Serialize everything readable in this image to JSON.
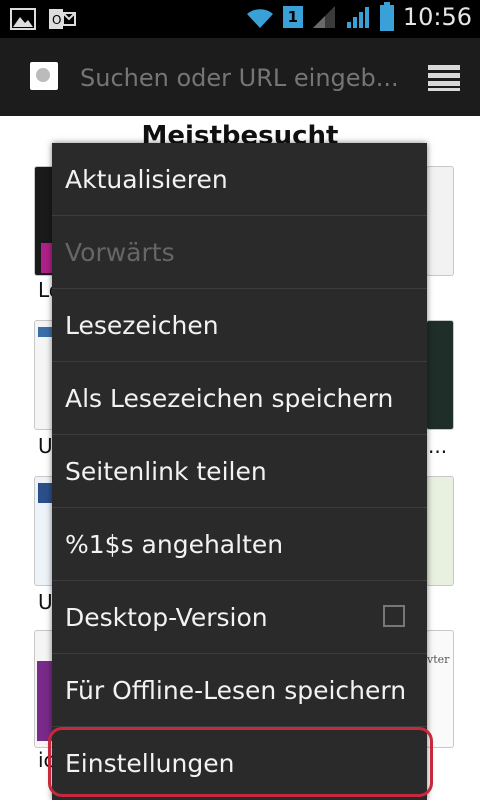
{
  "status_bar": {
    "time": "10:56",
    "sim_badge": "1",
    "icons": [
      "gallery-icon",
      "outlook-icon",
      "wifi-icon",
      "signal-icon",
      "battery-icon"
    ]
  },
  "url_bar": {
    "placeholder": "Suchen oder URL eingeb...",
    "icons": [
      "favicon-icon",
      "tabs-icon"
    ]
  },
  "content": {
    "title": "Meistbesucht",
    "thumb_labels": [
      "Lo",
      "U",
      "U",
      "ic"
    ],
    "right_labels": [
      "...",
      "vter"
    ]
  },
  "menu": {
    "items": [
      {
        "label": "Aktualisieren",
        "enabled": true
      },
      {
        "label": "Vorwärts",
        "enabled": false
      },
      {
        "label": "Lesezeichen",
        "enabled": true
      },
      {
        "label": "Als Lesezeichen speichern",
        "enabled": true
      },
      {
        "label": "Seitenlink teilen",
        "enabled": true
      },
      {
        "label": "%1$s angehalten",
        "enabled": true
      },
      {
        "label": "Desktop-Version",
        "enabled": true,
        "checked": false
      },
      {
        "label": "Für Offline-Lesen speichern",
        "enabled": true
      },
      {
        "label": "Einstellungen",
        "enabled": true
      }
    ]
  },
  "colors": {
    "highlight": "#c8283c",
    "menu_bg": "#2a2a2a",
    "urlbar_bg": "#1c1c1c"
  }
}
